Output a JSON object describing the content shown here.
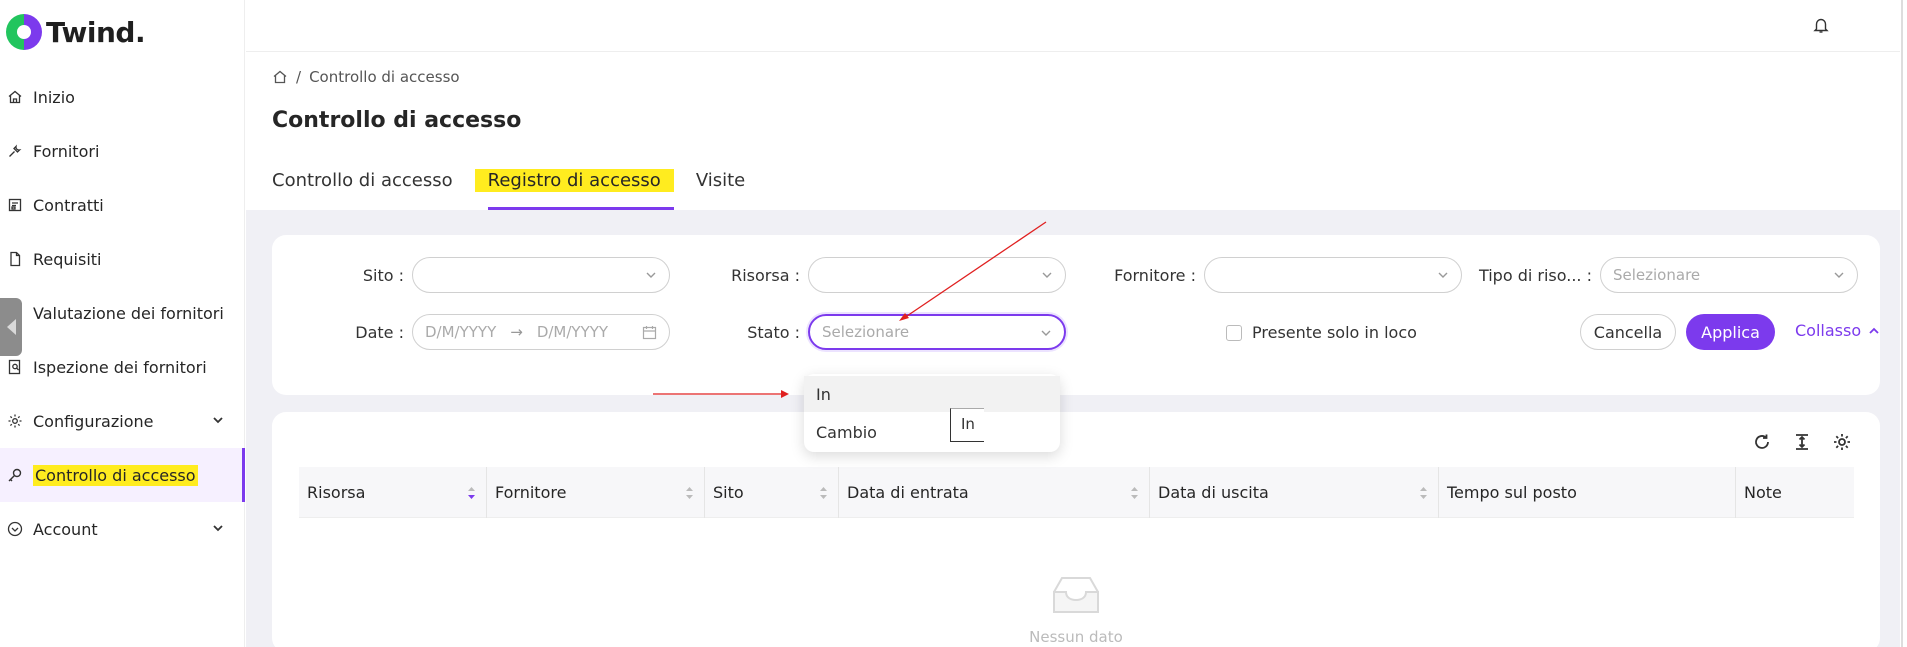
{
  "app": {
    "name": "Twind."
  },
  "sidebar": {
    "items": [
      {
        "label": "Inizio",
        "icon": "home-icon"
      },
      {
        "label": "Fornitori",
        "icon": "tool-icon"
      },
      {
        "label": "Contratti",
        "icon": "contract-icon"
      },
      {
        "label": "Requisiti",
        "icon": "document-icon"
      },
      {
        "label": "Valutazione dei fornitori",
        "icon": "shield-check-icon"
      },
      {
        "label": "Ispezione dei fornitori",
        "icon": "inspection-icon"
      },
      {
        "label": "Configurazione",
        "icon": "gear-icon"
      },
      {
        "label": "Controllo di accesso",
        "icon": "key-icon"
      },
      {
        "label": "Account",
        "icon": "user-circle-icon"
      }
    ]
  },
  "breadcrumb": {
    "current": "Controllo di accesso"
  },
  "page": {
    "title": "Controllo di accesso"
  },
  "tabs": [
    {
      "label": "Controllo di accesso"
    },
    {
      "label": "Registro di accesso"
    },
    {
      "label": "Visite"
    }
  ],
  "filters": {
    "sito_label": "Sito",
    "risorsa_label": "Risorsa",
    "fornitore_label": "Fornitore",
    "tipo_label": "Tipo di riso...",
    "tipo_placeholder": "Selezionare",
    "date_label": "Date",
    "date_start": "D/M/YYYY",
    "date_sep": "→",
    "date_end": "D/M/YYYY",
    "stato_label": "Stato",
    "stato_placeholder": "Selezionare",
    "presente_label": "Presente solo in loco",
    "cancel_label": "Cancella",
    "apply_label": "Applica",
    "collapse_label": "Collasso"
  },
  "stato_options": [
    {
      "label": "In"
    },
    {
      "label": "Cambio"
    }
  ],
  "tooltip": {
    "text": "In"
  },
  "table": {
    "columns": [
      "Risorsa",
      "Fornitore",
      "Sito",
      "Data di entrata",
      "Data di uscita",
      "Tempo sul posto",
      "Note"
    ],
    "empty_text": "Nessun dato"
  },
  "colors": {
    "accent": "#7c3aed",
    "highlight": "#ffec1f",
    "annotation": "#e02020"
  }
}
